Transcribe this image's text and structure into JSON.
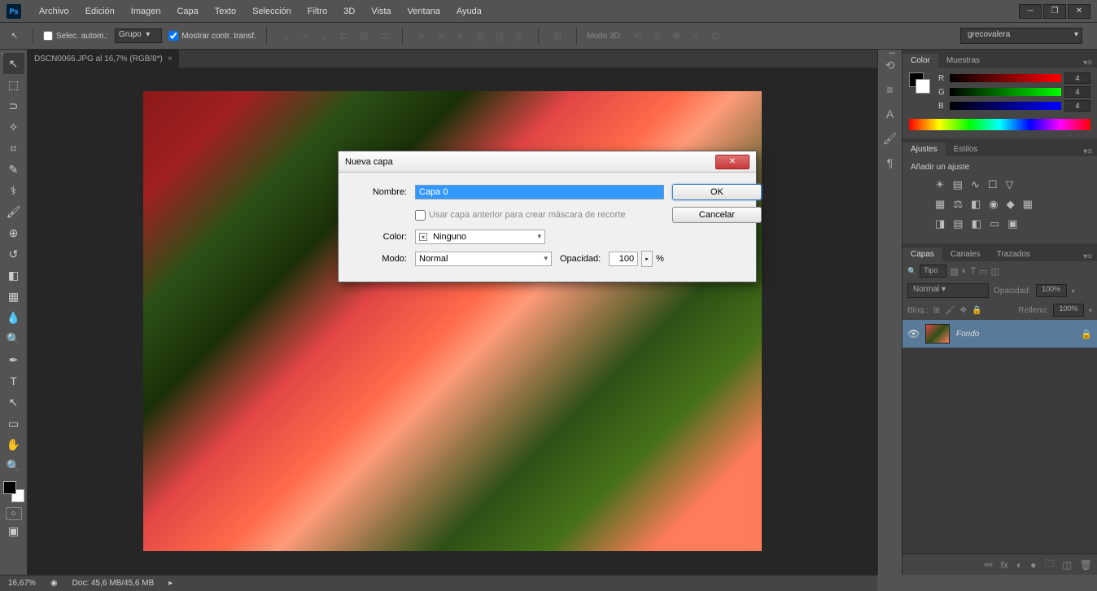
{
  "app": {
    "logo": "Ps"
  },
  "menu": [
    "Archivo",
    "Edición",
    "Imagen",
    "Capa",
    "Texto",
    "Selección",
    "Filtro",
    "3D",
    "Vista",
    "Ventana",
    "Ayuda"
  ],
  "options": {
    "auto_select": "Selec. autom.:",
    "group": "Grupo",
    "show_transform": "Mostrar contr. transf.",
    "mode3d": "Modo 3D:",
    "user": "grecovalera"
  },
  "doc": {
    "tab": "DSCN0066.JPG al 16,7% (RGB/8*)",
    "zoom": "16,67%",
    "size": "Doc: 45,6 MB/45,6 MB"
  },
  "panels": {
    "color": {
      "tab1": "Color",
      "tab2": "Muestras",
      "r": "R",
      "g": "G",
      "b": "B",
      "rv": "4",
      "gv": "4",
      "bv": "4"
    },
    "adjust": {
      "tab1": "Ajustes",
      "tab2": "Estilos",
      "title": "Añadir un ajuste"
    },
    "layers": {
      "tab1": "Capas",
      "tab2": "Canales",
      "tab3": "Trazados",
      "type": "Tipo",
      "blend": "Normal",
      "opacity_label": "Opacidad:",
      "opacity": "100%",
      "lock_label": "Bloq.:",
      "fill_label": "Relleno:",
      "fill": "100%",
      "layer_name": "Fondo"
    }
  },
  "dialog": {
    "title": "Nueva capa",
    "name_label": "Nombre:",
    "name_value": "Capa 0",
    "prev_mask": "Usar capa anterior para crear máscara de recorte",
    "color_label": "Color:",
    "color_value": "Ninguno",
    "mode_label": "Modo:",
    "mode_value": "Normal",
    "opacity_label": "Opacidad:",
    "opacity_value": "100",
    "percent": "%",
    "ok": "OK",
    "cancel": "Cancelar"
  }
}
